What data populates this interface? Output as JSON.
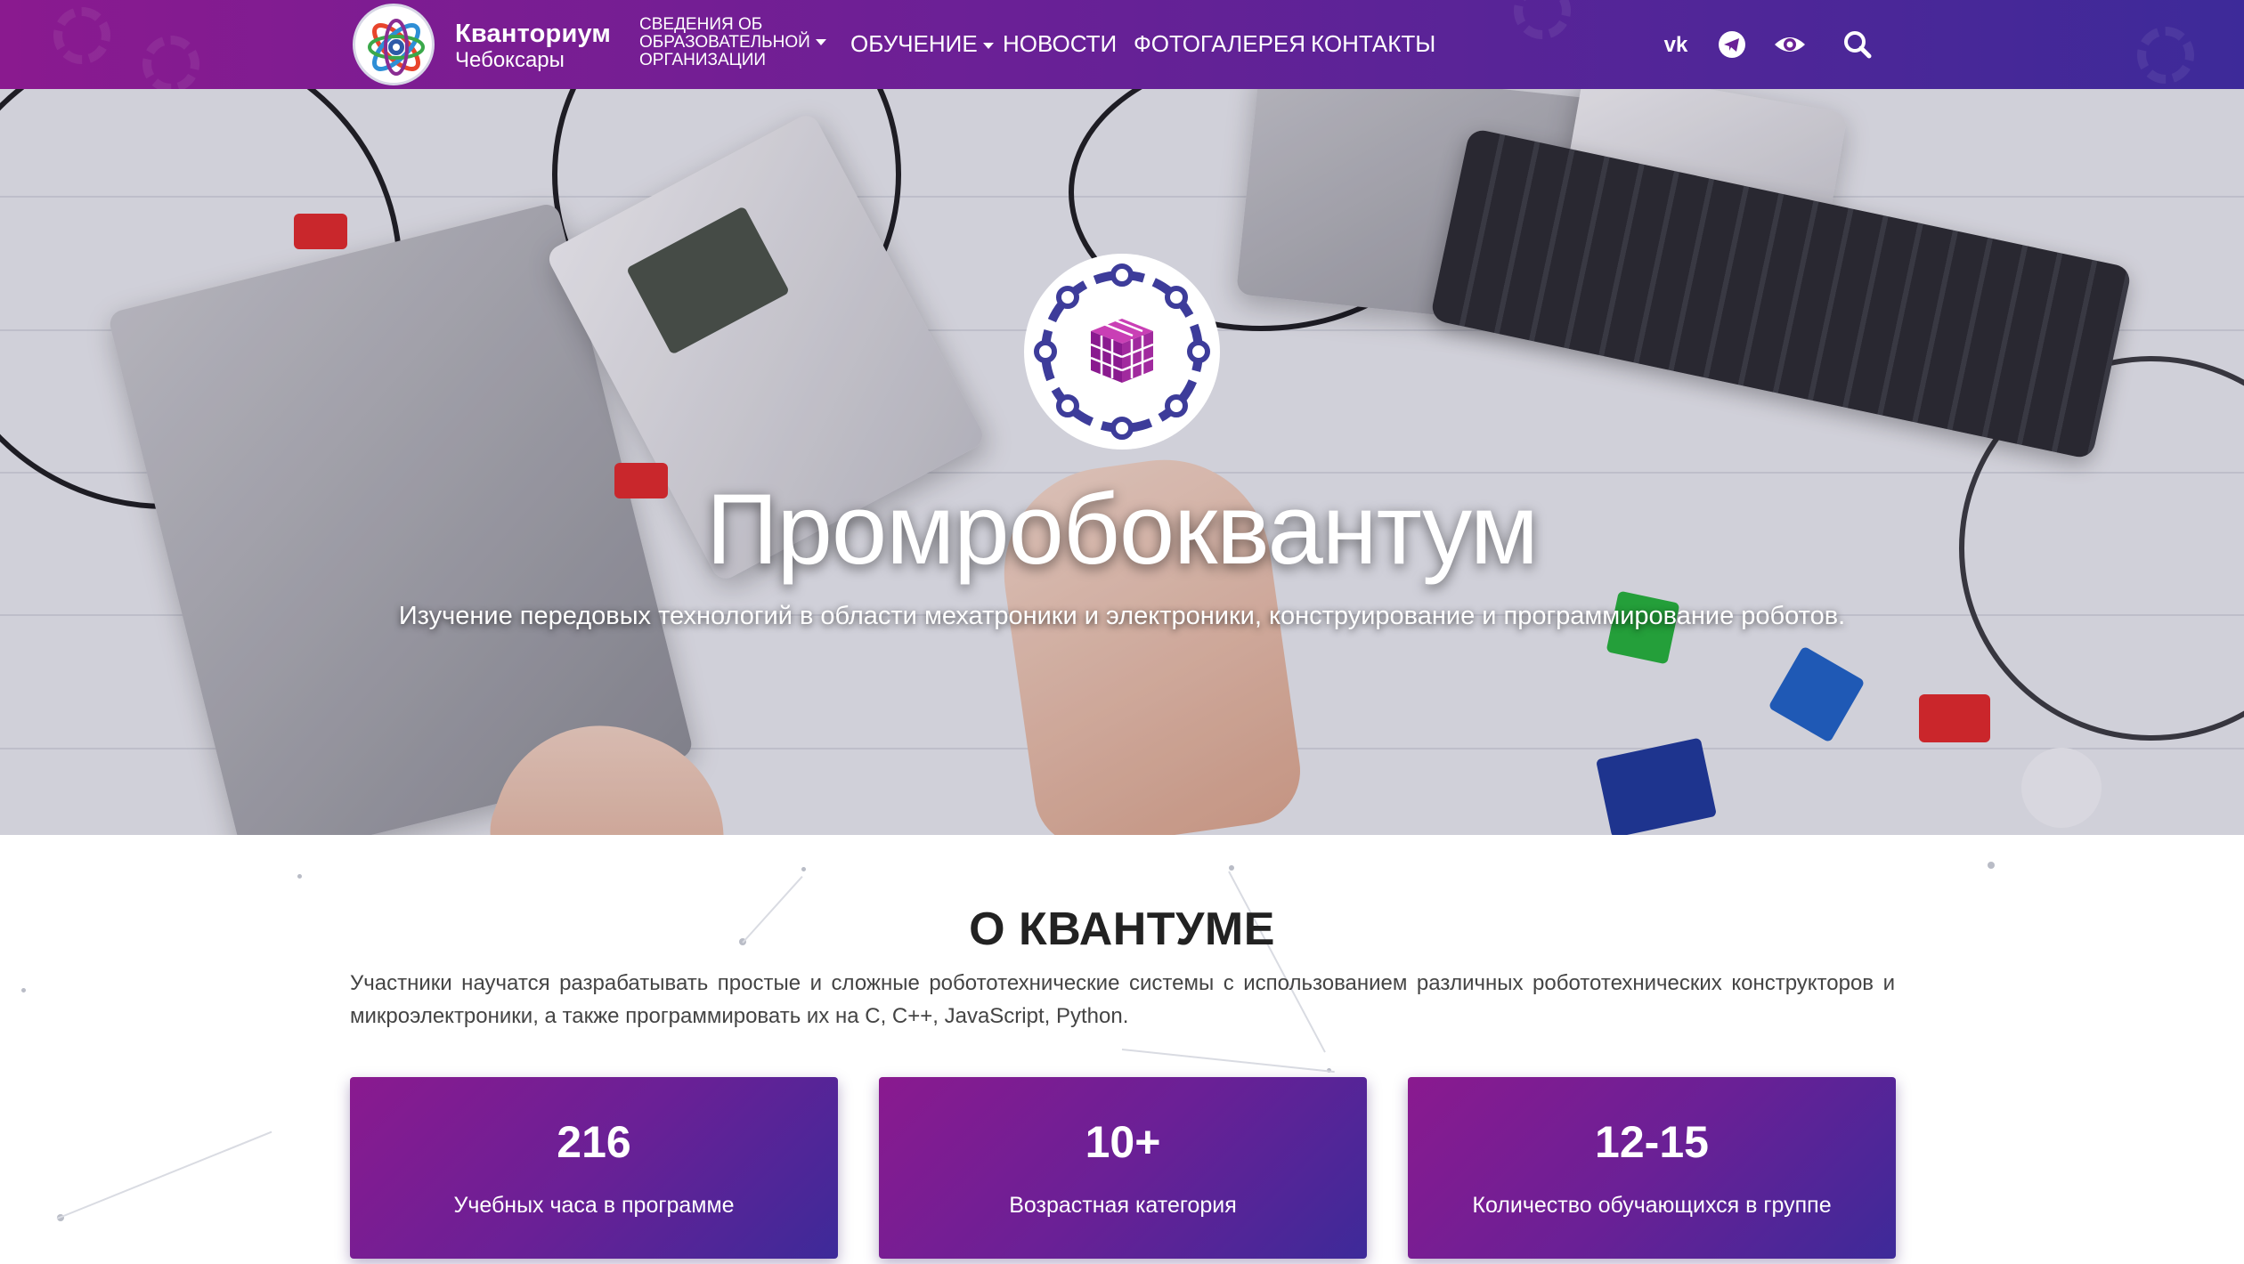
{
  "header": {
    "logo_title": "Кванториум",
    "logo_subtitle": "Чебоксары",
    "nav": {
      "org_info_lines": [
        "СВЕДЕНИЯ ОБ",
        "ОБРАЗОВАТЕЛЬНОЙ",
        "ОРГАНИЗАЦИИ"
      ],
      "education": "ОБУЧЕНИЕ",
      "news": "НОВОСТИ",
      "gallery": "ФОТОГАЛЕРЕЯ",
      "contacts": "КОНТАКТЫ"
    },
    "icons": [
      "vk-icon",
      "telegram-icon",
      "eye-icon",
      "search-icon"
    ]
  },
  "hero": {
    "title": "Промробоквантум",
    "subtitle": "Изучение передовых технологий в области мехатроники и электроники, конструирование и программирование роботов."
  },
  "about": {
    "title": "О КВАНТУМЕ",
    "text": "Участники научатся разрабатывать простые и сложные робототехнические системы с использованием различных робототехнических конструкторов и микроэлектроники, а также программировать их на C, C++, JavaScript, Python.",
    "stats": [
      {
        "value": "216",
        "label": "Учебных часа в программе"
      },
      {
        "value": "10+",
        "label": "Возрастная категория"
      },
      {
        "value": "12-15",
        "label": "Количество обучающихся в группе"
      }
    ]
  },
  "colors": {
    "brand_purple": "#8a1a8f",
    "brand_violet": "#6a2096",
    "brand_indigo": "#3d2a99"
  }
}
